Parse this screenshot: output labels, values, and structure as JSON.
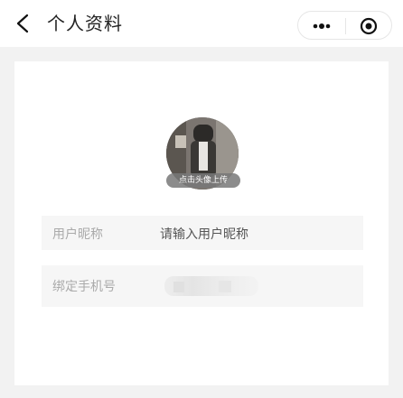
{
  "nav": {
    "title": "个人资料",
    "back_icon": "back-chevron-icon",
    "more_icon": "more-dots-icon",
    "close_icon": "target-circle-icon"
  },
  "profile": {
    "avatar_hint": "点击头像上传",
    "fields": [
      {
        "label": "用户昵称",
        "value": "请输入用户昵称"
      },
      {
        "label": "绑定手机号",
        "value": ""
      }
    ]
  }
}
